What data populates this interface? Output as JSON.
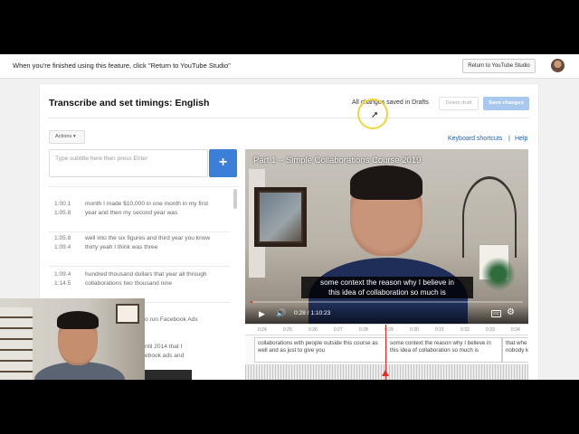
{
  "topbar": {
    "message": "When you're finished using this feature, click \"Return to YouTube Studio\"",
    "return_label": "Return to YouTube Studio"
  },
  "editor": {
    "title": "Transcribe and set timings: English",
    "saved_status": "All changes saved in Drafts",
    "delete_label": "Delete draft",
    "save_label": "Save changes",
    "actions_label": "Actions ▾",
    "keyboard_shortcuts": "Keyboard shortcuts",
    "separator": "|",
    "help": "Help",
    "subtitle_placeholder": "Type subtitle here then press Enter",
    "add_label": "+"
  },
  "cues": [
    {
      "start": "1:00.1",
      "end": "1:05.8",
      "text": "month I made $10,000 in one month in my first year and then my second year was"
    },
    {
      "start": "1:05.8",
      "end": "1:09.4",
      "text": "well into the six figures and third year you know thirty yeah I think was three"
    },
    {
      "start": "1:09.4",
      "end": "1:14.5",
      "text": "hundred thousand dollars that year all through collaborations two thousand nine"
    }
  ],
  "webcam_overlap_text": [
    "o run Facebook Ads",
    "",
    "ntil 2014 that I",
    "ebook ads and"
  ],
  "video": {
    "title": "Part 1 – Simple Collaborations Course 2019",
    "caption_line1": "some context the reason why I believe in",
    "caption_line2": "this idea of collaboration so much is",
    "time": "0:28 / 1:10:23",
    "progress_fraction": 0.007,
    "cc_label": "CC",
    "play_icon": "play-icon",
    "accent_color": "#e52d27"
  },
  "timeline": {
    "ticks": [
      "0:24",
      "0:25",
      "0:26",
      "0:27",
      "0:28",
      "0:29",
      "0:30",
      "0:31",
      "0:32",
      "0:33",
      "0:34"
    ],
    "segments": [
      "collaborations with people outside this course as well and as just to give you",
      "some context the reason why I believe in this idea of collaboration so much is",
      "that whe nobody k"
    ]
  },
  "colors": {
    "primary_blue": "#3b7fd9",
    "save_disabled": "#a9c8ee",
    "link": "#1a5fb4"
  }
}
